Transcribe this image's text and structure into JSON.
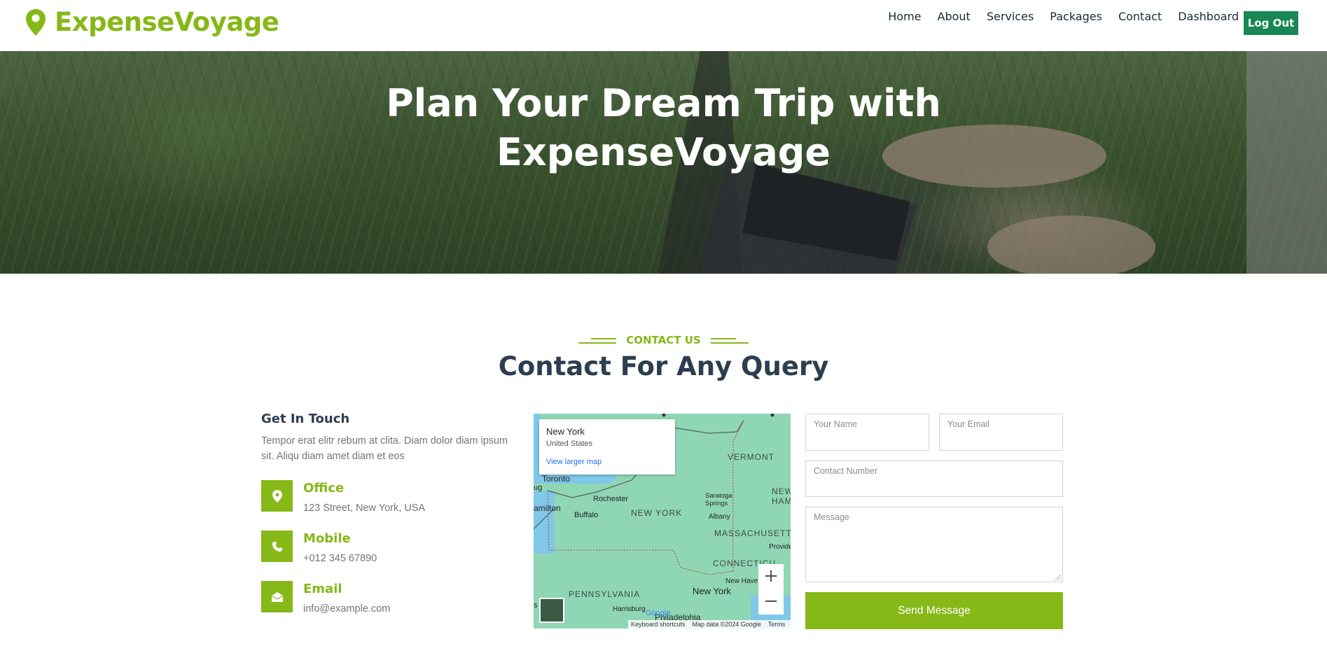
{
  "brand": {
    "name": "ExpenseVoyage",
    "icon": "map-pin-icon",
    "color": "#86b817"
  },
  "nav": {
    "items": [
      {
        "label": "Home"
      },
      {
        "label": "About"
      },
      {
        "label": "Services"
      },
      {
        "label": "Packages"
      },
      {
        "label": "Contact"
      },
      {
        "label": "Dashboard"
      }
    ],
    "logout_label": "Log Out",
    "logout_color": "#198754"
  },
  "hero": {
    "title_line1": "Plan Your Dream Trip with",
    "title_line2": "ExpenseVoyage"
  },
  "contact": {
    "tag": "CONTACT US",
    "title": "Contact For Any Query",
    "get_in_touch": {
      "title": "Get In Touch",
      "description": "Tempor erat elitr rebum at clita. Diam dolor diam ipsum sit. Aliqu diam amet diam et eos"
    },
    "info": [
      {
        "label": "Office",
        "value": "123 Street, New York, USA",
        "icon": "location-pin-icon"
      },
      {
        "label": "Mobile",
        "value": "+012 345 67890",
        "icon": "phone-icon"
      },
      {
        "label": "Email",
        "value": "info@example.com",
        "icon": "envelope-open-icon"
      }
    ]
  },
  "map": {
    "card_title": "New York",
    "card_subtitle": "United States",
    "card_link": "View larger map",
    "labels": {
      "vermont": "VERMONT",
      "new_hamps": "NEW\nHAMPS",
      "toronto": "Toronto",
      "hamilton": "amilton",
      "rochester": "Rochester",
      "buffalo": "Buffalo",
      "new_york_state": "NEW YORK",
      "saratoga": "Saratoga\nSprings",
      "albany": "Albany",
      "massachusetts": "MASSACHUSETT",
      "connecticut": "CONNECTICU",
      "provide": "Provide",
      "new_haven": "New Have",
      "new_york_city": "New York",
      "pennsylvania": "PENNSYLVANIA",
      "harrisburg": "Harrisburg",
      "philadelphia": "Philadelphia",
      "ug": "ug",
      "s": "s"
    },
    "zoom_in": "+",
    "zoom_out": "−",
    "footer": {
      "shortcuts": "Keyboard shortcuts",
      "data": "Map data ©2024 Google",
      "terms": "Terms"
    },
    "google": "Google"
  },
  "form": {
    "name_label": "Your Name",
    "email_label": "Your Email",
    "phone_label": "Contact Number",
    "message_label": "Message",
    "submit_label": "Send Message"
  }
}
